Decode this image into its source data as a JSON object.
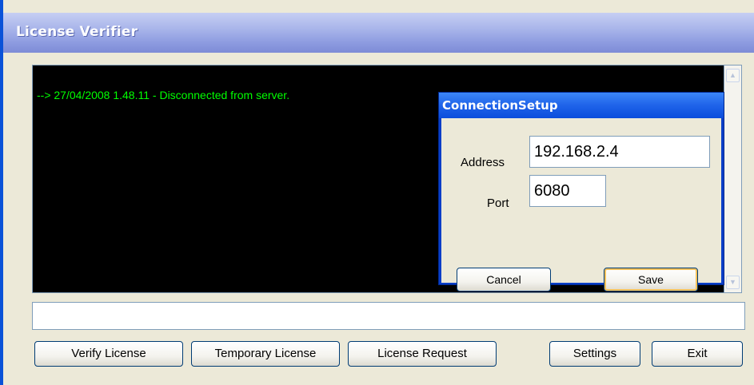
{
  "window": {
    "title": "License Verifier"
  },
  "console": {
    "lines": [
      "--> 27/04/2008 1.48.11 - Disconnected from server."
    ]
  },
  "connection_dialog": {
    "title": "ConnectionSetup",
    "address_label": "Address",
    "address_value": "192.168.2.4",
    "port_label": "Port",
    "port_value": "6080",
    "cancel_label": "Cancel",
    "save_label": "Save"
  },
  "status_field": {
    "value": ""
  },
  "buttons": {
    "verify_license": "Verify License",
    "temporary_license": "Temporary License",
    "license_request": "License Request",
    "settings": "Settings",
    "exit": "Exit"
  },
  "colors": {
    "console_background": "#000000",
    "console_text": "#00ff00",
    "dialog_title": "#0b4ddc",
    "window_face": "#ece9d8"
  },
  "icons": {
    "scroll_up": "chevron-up-icon",
    "scroll_down": "chevron-down-icon"
  }
}
